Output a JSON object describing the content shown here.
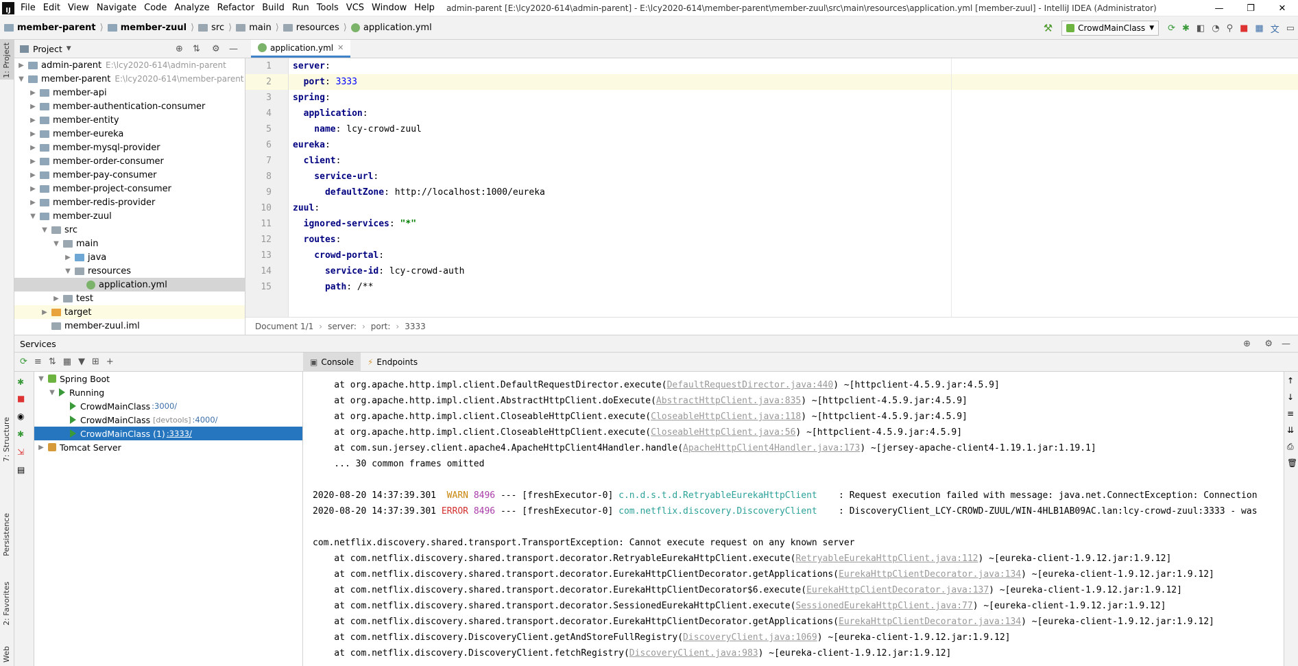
{
  "window": {
    "menu": [
      "File",
      "Edit",
      "View",
      "Navigate",
      "Code",
      "Analyze",
      "Refactor",
      "Build",
      "Run",
      "Tools",
      "VCS",
      "Window",
      "Help"
    ],
    "title": "admin-parent [E:\\lcy2020-614\\admin-parent] - E:\\lcy2020-614\\member-parent\\member-zuul\\src\\main\\resources\\application.yml [member-zuul] - IntelliJ IDEA (Administrator)",
    "controls": {
      "minimize": "—",
      "maximize": "❐",
      "close": "✕"
    }
  },
  "navbar": {
    "breadcrumbs": [
      "member-parent",
      "member-zuul",
      "src",
      "main",
      "resources",
      "application.yml"
    ],
    "run_config": "CrowdMainClass"
  },
  "left_strip": {
    "project": "1: Project",
    "structure": "7: Structure",
    "persistence": "Persistence",
    "favorites": "2: Favorites",
    "web": "Web"
  },
  "project": {
    "header": "Project",
    "tree": [
      {
        "label": "admin-parent",
        "path": "E:\\lcy2020-614\\admin-parent",
        "indent": 0,
        "arrow": "▶",
        "icon": "mod"
      },
      {
        "label": "member-parent",
        "path": "E:\\lcy2020-614\\member-parent",
        "indent": 0,
        "arrow": "▼",
        "icon": "mod"
      },
      {
        "label": "member-api",
        "indent": 1,
        "arrow": "▶",
        "icon": "mod"
      },
      {
        "label": "member-authentication-consumer",
        "indent": 1,
        "arrow": "▶",
        "icon": "mod"
      },
      {
        "label": "member-entity",
        "indent": 1,
        "arrow": "▶",
        "icon": "mod"
      },
      {
        "label": "member-eureka",
        "indent": 1,
        "arrow": "▶",
        "icon": "mod"
      },
      {
        "label": "member-mysql-provider",
        "indent": 1,
        "arrow": "▶",
        "icon": "mod"
      },
      {
        "label": "member-order-consumer",
        "indent": 1,
        "arrow": "▶",
        "icon": "mod"
      },
      {
        "label": "member-pay-consumer",
        "indent": 1,
        "arrow": "▶",
        "icon": "mod"
      },
      {
        "label": "member-project-consumer",
        "indent": 1,
        "arrow": "▶",
        "icon": "mod"
      },
      {
        "label": "member-redis-provider",
        "indent": 1,
        "arrow": "▶",
        "icon": "mod"
      },
      {
        "label": "member-zuul",
        "indent": 1,
        "arrow": "▼",
        "icon": "mod"
      },
      {
        "label": "src",
        "indent": 2,
        "arrow": "▼",
        "icon": "folder"
      },
      {
        "label": "main",
        "indent": 3,
        "arrow": "▼",
        "icon": "folder"
      },
      {
        "label": "java",
        "indent": 4,
        "arrow": "▶",
        "icon": "blue"
      },
      {
        "label": "resources",
        "indent": 4,
        "arrow": "▼",
        "icon": "folder"
      },
      {
        "label": "application.yml",
        "indent": 5,
        "arrow": "",
        "icon": "yml",
        "selected": true
      },
      {
        "label": "test",
        "indent": 3,
        "arrow": "▶",
        "icon": "folder"
      },
      {
        "label": "target",
        "indent": 2,
        "arrow": "▶",
        "icon": "orange",
        "highlight": true
      },
      {
        "label": "member-zuul.iml",
        "indent": 2,
        "arrow": "",
        "icon": "file"
      }
    ]
  },
  "editor": {
    "tab": "application.yml",
    "lines": [
      [
        {
          "t": "server",
          "c": "k"
        },
        {
          "t": ":",
          "c": ""
        }
      ],
      [
        {
          "t": "  port",
          "c": "k"
        },
        {
          "t": ": ",
          "c": ""
        },
        {
          "t": "3333",
          "c": "num"
        }
      ],
      [
        {
          "t": "spring",
          "c": "k"
        },
        {
          "t": ":",
          "c": ""
        }
      ],
      [
        {
          "t": "  application",
          "c": "k"
        },
        {
          "t": ":",
          "c": ""
        }
      ],
      [
        {
          "t": "    name",
          "c": "k"
        },
        {
          "t": ": lcy-crowd-zuul",
          "c": ""
        }
      ],
      [
        {
          "t": "eureka",
          "c": "k"
        },
        {
          "t": ":",
          "c": ""
        }
      ],
      [
        {
          "t": "  client",
          "c": "k"
        },
        {
          "t": ":",
          "c": ""
        }
      ],
      [
        {
          "t": "    service-url",
          "c": "k"
        },
        {
          "t": ":",
          "c": ""
        }
      ],
      [
        {
          "t": "      defaultZone",
          "c": "k"
        },
        {
          "t": ": http://localhost:1000/eureka",
          "c": ""
        }
      ],
      [
        {
          "t": "zuul",
          "c": "k"
        },
        {
          "t": ":",
          "c": ""
        }
      ],
      [
        {
          "t": "  ignored-services",
          "c": "k"
        },
        {
          "t": ": ",
          "c": ""
        },
        {
          "t": "\"*\"",
          "c": "str"
        }
      ],
      [
        {
          "t": "  routes",
          "c": "k"
        },
        {
          "t": ":",
          "c": ""
        }
      ],
      [
        {
          "t": "    crowd-portal",
          "c": "k"
        },
        {
          "t": ":",
          "c": ""
        }
      ],
      [
        {
          "t": "      service-id",
          "c": "k"
        },
        {
          "t": ": lcy-crowd-auth",
          "c": ""
        }
      ],
      [
        {
          "t": "      path",
          "c": "k"
        },
        {
          "t": ": /**",
          "c": ""
        }
      ]
    ],
    "current_line": 2,
    "status": [
      "Document 1/1",
      "server:",
      "port:",
      "3333"
    ]
  },
  "services": {
    "header": "Services",
    "tree": [
      {
        "label": "Spring Boot",
        "indent": 0,
        "arrow": "▼",
        "icon": "leaf"
      },
      {
        "label": "Running",
        "indent": 1,
        "arrow": "▼",
        "icon": "play"
      },
      {
        "label": "CrowdMainClass",
        "dev": "",
        "port": ":3000/",
        "indent": 2,
        "icon": "play"
      },
      {
        "label": "CrowdMainClass",
        "dev": "[devtools]",
        "port": ":4000/",
        "indent": 2,
        "icon": "play"
      },
      {
        "label": "CrowdMainClass (1)",
        "dev": "",
        "port": ":3333/",
        "indent": 2,
        "icon": "play",
        "selected": true
      },
      {
        "label": "Tomcat Server",
        "indent": 0,
        "arrow": "▶",
        "icon": "cat"
      }
    ],
    "console_tabs": [
      "Console",
      "Endpoints"
    ]
  },
  "console": [
    [
      {
        "t": "    at org.apache.http.impl.client.DefaultRequestDirector.execute(",
        "c": ""
      },
      {
        "t": "DefaultRequestDirector.java:440",
        "c": "lnk"
      },
      {
        "t": ") ~[httpclient-4.5.9.jar:4.5.9]",
        "c": ""
      }
    ],
    [
      {
        "t": "    at org.apache.http.impl.client.AbstractHttpClient.doExecute(",
        "c": ""
      },
      {
        "t": "AbstractHttpClient.java:835",
        "c": "lnk"
      },
      {
        "t": ") ~[httpclient-4.5.9.jar:4.5.9]",
        "c": ""
      }
    ],
    [
      {
        "t": "    at org.apache.http.impl.client.CloseableHttpClient.execute(",
        "c": ""
      },
      {
        "t": "CloseableHttpClient.java:118",
        "c": "lnk"
      },
      {
        "t": ") ~[httpclient-4.5.9.jar:4.5.9]",
        "c": ""
      }
    ],
    [
      {
        "t": "    at org.apache.http.impl.client.CloseableHttpClient.execute(",
        "c": ""
      },
      {
        "t": "CloseableHttpClient.java:56",
        "c": "lnk"
      },
      {
        "t": ") ~[httpclient-4.5.9.jar:4.5.9]",
        "c": ""
      }
    ],
    [
      {
        "t": "    at com.sun.jersey.client.apache4.ApacheHttpClient4Handler.handle(",
        "c": ""
      },
      {
        "t": "ApacheHttpClient4Handler.java:173",
        "c": "lnk"
      },
      {
        "t": ") ~[jersey-apache-client4-1.19.1.jar:1.19.1]",
        "c": ""
      }
    ],
    [
      {
        "t": "    ... 30 common frames omitted",
        "c": ""
      }
    ],
    [
      {
        "t": "",
        "c": ""
      }
    ],
    [
      {
        "t": "2020-08-20 14:37:39.301  ",
        "c": ""
      },
      {
        "t": "WARN",
        "c": "warn"
      },
      {
        "t": " ",
        "c": ""
      },
      {
        "t": "8496",
        "c": "pid"
      },
      {
        "t": " --- [freshExecutor-0] ",
        "c": ""
      },
      {
        "t": "c.n.d.s.t.d.RetryableEurekaHttpClient   ",
        "c": "logger"
      },
      {
        "t": " : Request execution failed with message: java.net.ConnectException: Connection",
        "c": ""
      }
    ],
    [
      {
        "t": "2020-08-20 14:37:39.301 ",
        "c": ""
      },
      {
        "t": "ERROR",
        "c": "err"
      },
      {
        "t": " ",
        "c": ""
      },
      {
        "t": "8496",
        "c": "pid"
      },
      {
        "t": " --- [freshExecutor-0] ",
        "c": ""
      },
      {
        "t": "com.netflix.discovery.DiscoveryClient   ",
        "c": "logger"
      },
      {
        "t": " : DiscoveryClient_LCY-CROWD-ZUUL/WIN-4HLB1AB09AC.lan:lcy-crowd-zuul:3333 - was",
        "c": ""
      }
    ],
    [
      {
        "t": "",
        "c": ""
      }
    ],
    [
      {
        "t": "com.netflix.discovery.shared.transport.TransportException: Cannot execute request on any known server",
        "c": ""
      }
    ],
    [
      {
        "t": "    at com.netflix.discovery.shared.transport.decorator.RetryableEurekaHttpClient.execute(",
        "c": ""
      },
      {
        "t": "RetryableEurekaHttpClient.java:112",
        "c": "lnk"
      },
      {
        "t": ") ~[eureka-client-1.9.12.jar:1.9.12]",
        "c": ""
      }
    ],
    [
      {
        "t": "    at com.netflix.discovery.shared.transport.decorator.EurekaHttpClientDecorator.getApplications(",
        "c": ""
      },
      {
        "t": "EurekaHttpClientDecorator.java:134",
        "c": "lnk"
      },
      {
        "t": ") ~[eureka-client-1.9.12.jar:1.9.12]",
        "c": ""
      }
    ],
    [
      {
        "t": "    at com.netflix.discovery.shared.transport.decorator.EurekaHttpClientDecorator$6.execute(",
        "c": ""
      },
      {
        "t": "EurekaHttpClientDecorator.java:137",
        "c": "lnk"
      },
      {
        "t": ") ~[eureka-client-1.9.12.jar:1.9.12]",
        "c": ""
      }
    ],
    [
      {
        "t": "    at com.netflix.discovery.shared.transport.decorator.SessionedEurekaHttpClient.execute(",
        "c": ""
      },
      {
        "t": "SessionedEurekaHttpClient.java:77",
        "c": "lnk"
      },
      {
        "t": ") ~[eureka-client-1.9.12.jar:1.9.12]",
        "c": ""
      }
    ],
    [
      {
        "t": "    at com.netflix.discovery.shared.transport.decorator.EurekaHttpClientDecorator.getApplications(",
        "c": ""
      },
      {
        "t": "EurekaHttpClientDecorator.java:134",
        "c": "lnk"
      },
      {
        "t": ") ~[eureka-client-1.9.12.jar:1.9.12]",
        "c": ""
      }
    ],
    [
      {
        "t": "    at com.netflix.discovery.DiscoveryClient.getAndStoreFullRegistry(",
        "c": ""
      },
      {
        "t": "DiscoveryClient.java:1069",
        "c": "lnk"
      },
      {
        "t": ") ~[eureka-client-1.9.12.jar:1.9.12]",
        "c": ""
      }
    ],
    [
      {
        "t": "    at com.netflix.discovery.DiscoveryClient.fetchRegistry(",
        "c": ""
      },
      {
        "t": "DiscoveryClient.java:983",
        "c": "lnk"
      },
      {
        "t": ") ~[eureka-client-1.9.12.jar:1.9.12]",
        "c": ""
      }
    ]
  ]
}
